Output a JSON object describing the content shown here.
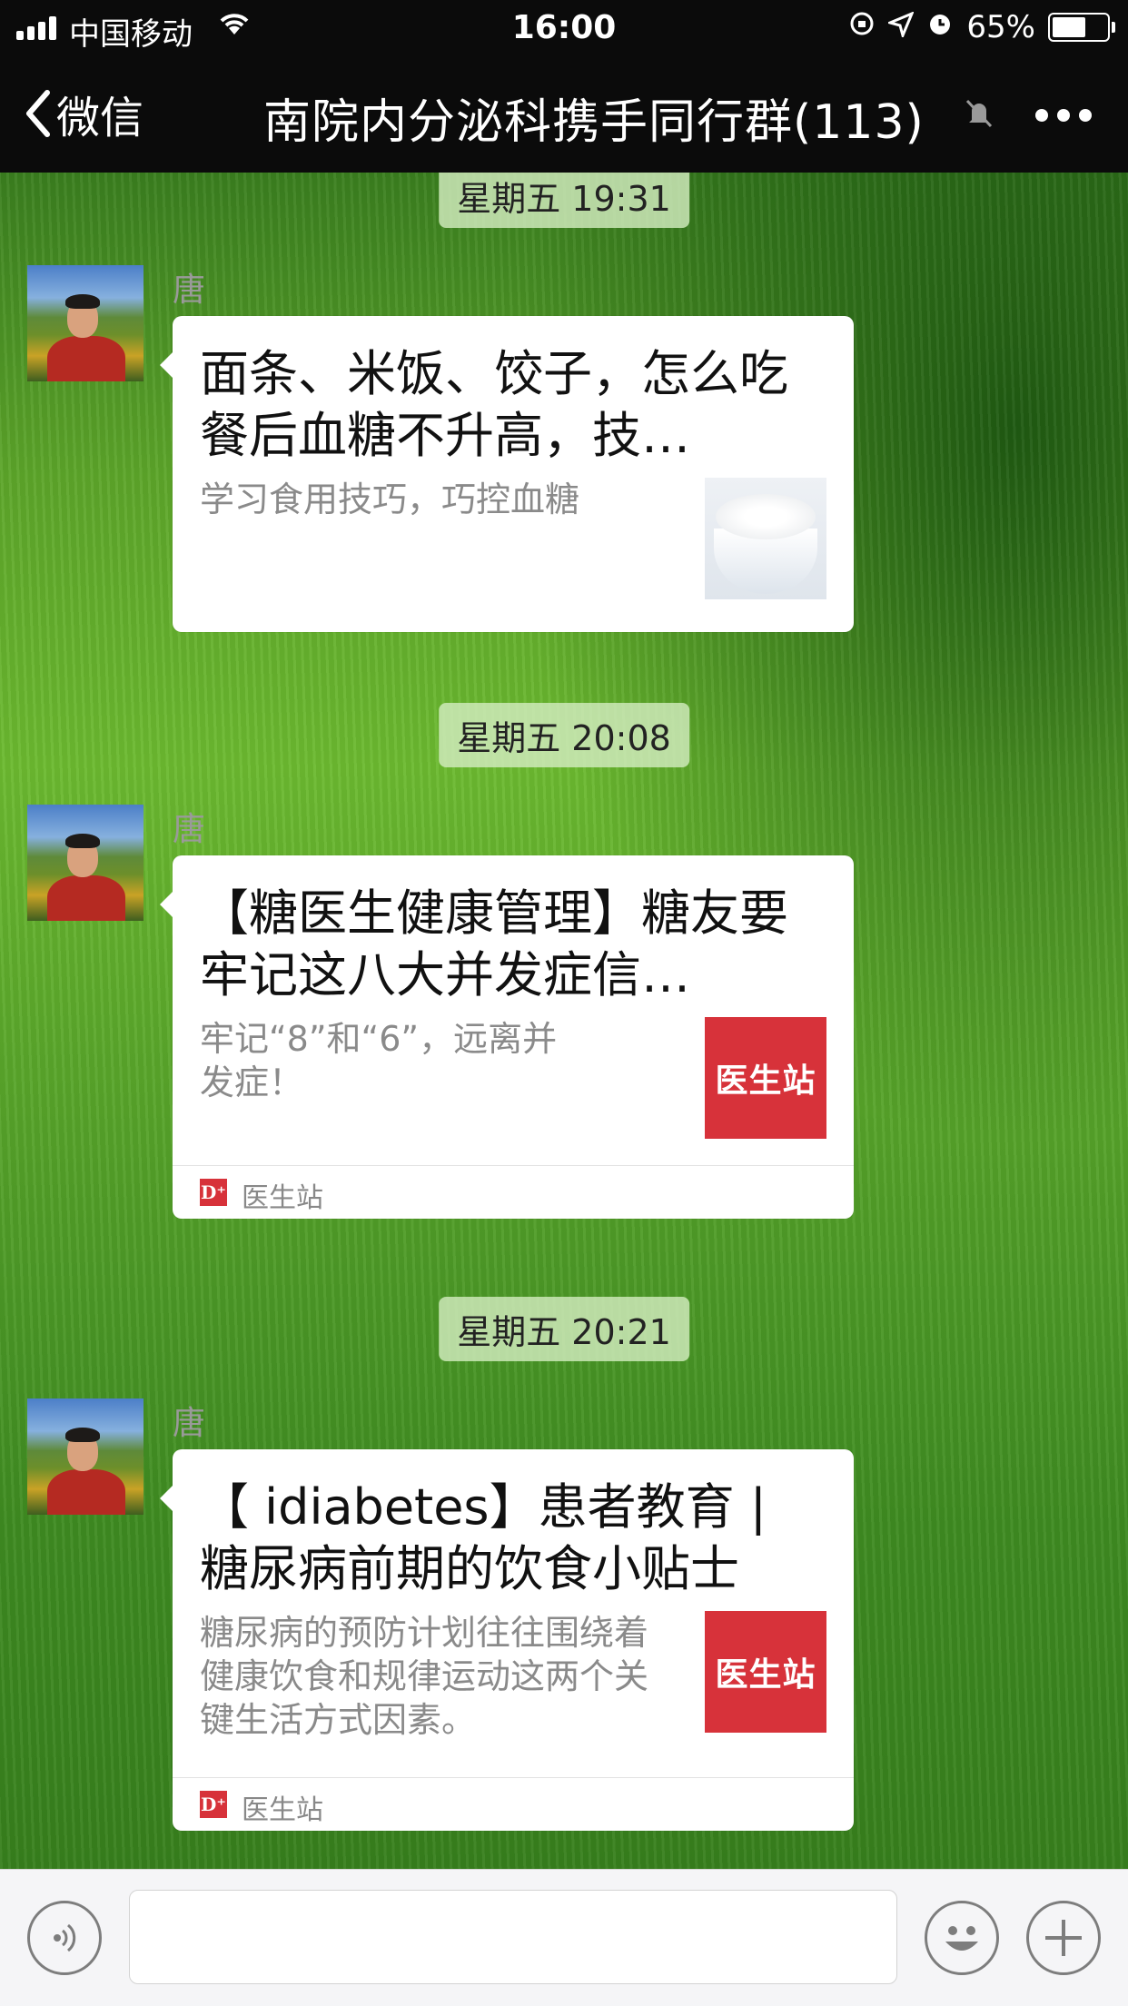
{
  "status_bar": {
    "carrier": "中国移动",
    "time": "16:00",
    "battery_percent": "65%",
    "battery_level": 0.65
  },
  "nav": {
    "back_label": "微信",
    "title": "南院内分泌科携手同行群(113)"
  },
  "messages": [
    {
      "timestamp": "星期五 19:31",
      "sender": "唐",
      "title": "面条、米饭、饺子，怎么吃餐后血糖不升高，技…",
      "desc": "学习食用技巧，巧控血糖",
      "thumb": "rice-bowl-image"
    },
    {
      "timestamp": "星期五 20:08",
      "sender": "唐",
      "title": "【糖医生健康管理】糖友要牢记这八大并发症信…",
      "desc": "牢记“8”和“6”，远离并发症！",
      "thumb_text": "医生站",
      "source": "医生站"
    },
    {
      "timestamp": "星期五 20:21",
      "sender": "唐",
      "title": "【 idiabetes】患者教育 | 糖尿病前期的饮食小贴士",
      "desc": "糖尿病的预防计划往往围绕着健康饮食和规律运动这两个关键生活方式因素。",
      "thumb_text": "医生站",
      "source": "医生站"
    }
  ],
  "icons": {
    "d_logo": "D⁺"
  },
  "colors": {
    "brand_red": "#d7323a",
    "nav_bg": "#0b0b0b"
  }
}
